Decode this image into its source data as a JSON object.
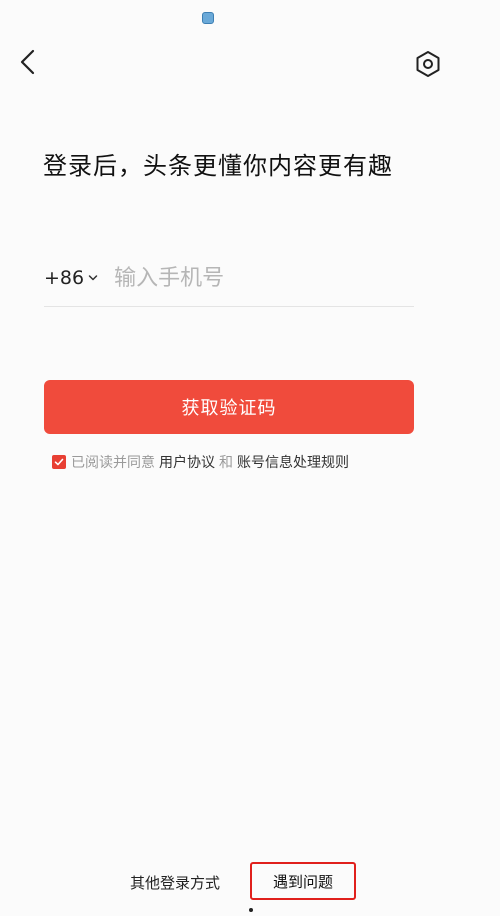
{
  "header": {
    "back_icon": "chevron-left-icon",
    "settings_icon": "gear-hexagon-icon"
  },
  "headline": "登录后，头条更懂你内容更有趣",
  "phone": {
    "country_code": "+86",
    "placeholder": "输入手机号",
    "value": ""
  },
  "primary_button": {
    "label": "获取验证码",
    "color": "#f04b3c"
  },
  "agreement": {
    "checked": true,
    "prefix": "已阅读并同意",
    "link_user_agreement": "用户协议",
    "and": "和",
    "link_privacy": "账号信息处理规则"
  },
  "footer": {
    "other_login": "其他登录方式",
    "problem": "遇到问题"
  }
}
